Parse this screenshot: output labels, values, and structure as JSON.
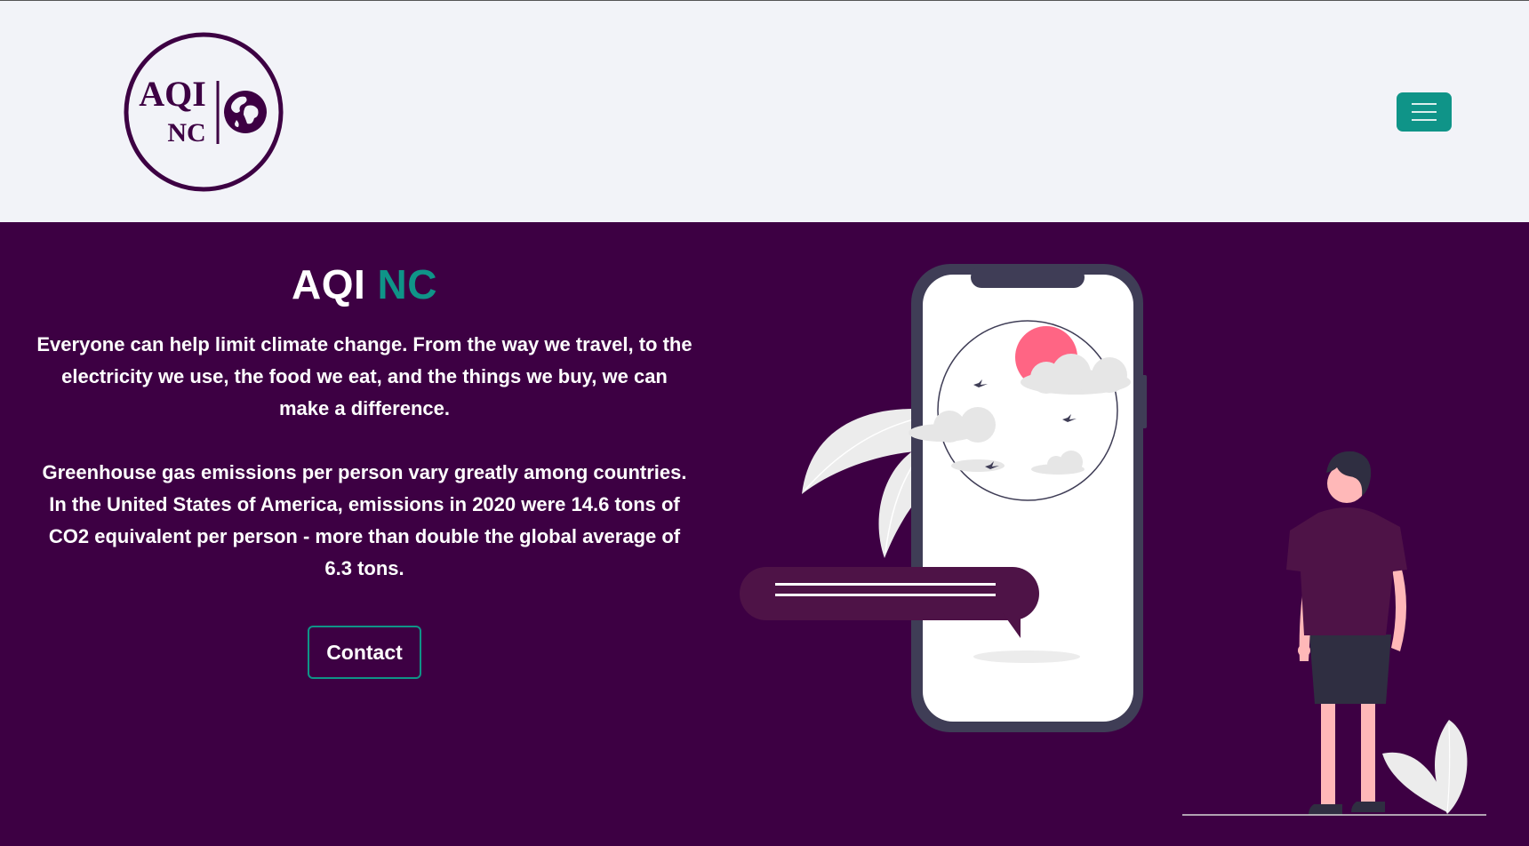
{
  "header": {
    "logo": {
      "line1": "AQI",
      "line2": "NC",
      "icon": "globe-icon"
    },
    "menu_icon": "hamburger-menu-icon"
  },
  "hero": {
    "title_main": "AQI",
    "title_accent": "NC",
    "paragraph1": "Everyone can help limit climate change. From the way we travel, to the electricity we use, the food we eat, and the things we buy, we can make a difference.",
    "paragraph2": "Greenhouse gas emissions per person vary greatly among countries. In the United States of America, emissions in 2020 were 14.6 tons of CO2 equivalent per person - more than double the global average of 6.3 tons.",
    "contact_label": "Contact"
  },
  "colors": {
    "brand_purple": "#3d0043",
    "accent_teal": "#0f9488",
    "header_bg": "#f2f3f8",
    "sun_pink": "#ff6584"
  }
}
